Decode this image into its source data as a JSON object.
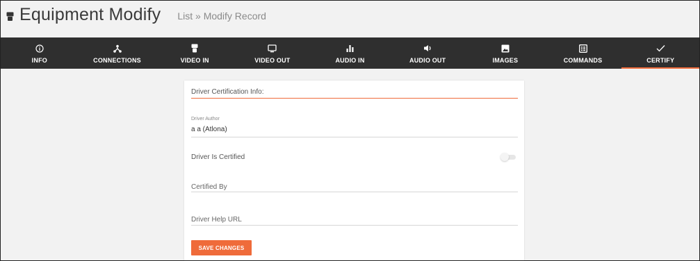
{
  "header": {
    "title": "Equipment Modify",
    "breadcrumb": {
      "list": "List",
      "separator": " » ",
      "current": "Modify Record"
    }
  },
  "nav": {
    "tabs": [
      {
        "label": "INFO",
        "icon": "info-icon"
      },
      {
        "label": "CONNECTIONS",
        "icon": "connections-icon"
      },
      {
        "label": "VIDEO IN",
        "icon": "video-in-icon"
      },
      {
        "label": "VIDEO OUT",
        "icon": "monitor-icon"
      },
      {
        "label": "AUDIO IN",
        "icon": "bars-icon"
      },
      {
        "label": "AUDIO OUT",
        "icon": "speaker-icon"
      },
      {
        "label": "IMAGES",
        "icon": "image-icon"
      },
      {
        "label": "COMMANDS",
        "icon": "commands-icon"
      },
      {
        "label": "CERTIFY",
        "icon": "check-icon",
        "active": true
      }
    ]
  },
  "form": {
    "section_title": "Driver Certification Info:",
    "author_label": "Driver Author",
    "author_value": "a a (Atlona)",
    "certified_label": "Driver Is Certified",
    "certified_value": false,
    "certified_by_placeholder": "Certified By",
    "help_url_placeholder": "Driver Help URL",
    "save_label": "SAVE CHANGES"
  },
  "colors": {
    "accent": "#ef6b3a",
    "nav_bg": "#2f2f2f"
  }
}
